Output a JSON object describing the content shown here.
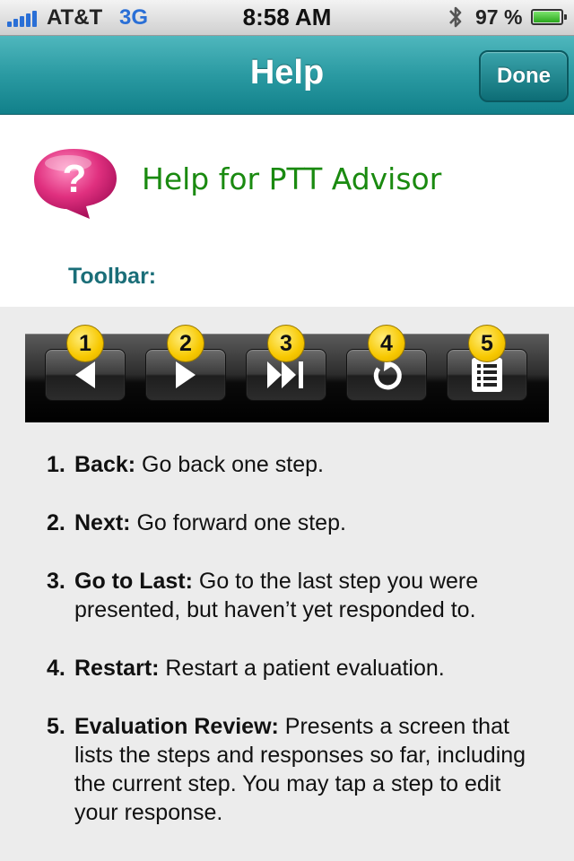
{
  "status_bar": {
    "carrier": "AT&T",
    "network": "3G",
    "time": "8:58 AM",
    "battery_percent": "97 %",
    "battery_level": 0.97,
    "icons": [
      "signal-icon",
      "bluetooth-icon",
      "battery-icon"
    ]
  },
  "nav": {
    "title": "Help",
    "done_label": "Done"
  },
  "header": {
    "icon": "help-bubble-icon",
    "title": "Help for PTT Advisor",
    "toolbar_label": "Toolbar:"
  },
  "toolbar": {
    "buttons": [
      {
        "badge": "1",
        "icon": "back-arrow-icon"
      },
      {
        "badge": "2",
        "icon": "next-arrow-icon"
      },
      {
        "badge": "3",
        "icon": "go-to-last-icon"
      },
      {
        "badge": "4",
        "icon": "restart-icon"
      },
      {
        "badge": "5",
        "icon": "evaluation-review-icon"
      }
    ]
  },
  "descriptions": [
    {
      "num": "1.",
      "term": "Back:",
      "text": " Go back one step."
    },
    {
      "num": "2.",
      "term": "Next:",
      "text": " Go forward one step."
    },
    {
      "num": "3.",
      "term": "Go to Last:",
      "text": " Go to the last step you were presented, but haven’t yet responded to."
    },
    {
      "num": "4.",
      "term": "Restart:",
      "text": " Restart a patient evaluation."
    },
    {
      "num": "5.",
      "term": "Evaluation Review:",
      "text": " Presents a screen that lists the steps and responses so far, including the current step. You may tap a step to edit your response."
    }
  ],
  "colors": {
    "nav_teal": "#2a9aa2",
    "title_green": "#1a8a10",
    "label_teal": "#1a6e78",
    "badge_yellow": "#f7c800",
    "help_pink": "#d8287a"
  }
}
